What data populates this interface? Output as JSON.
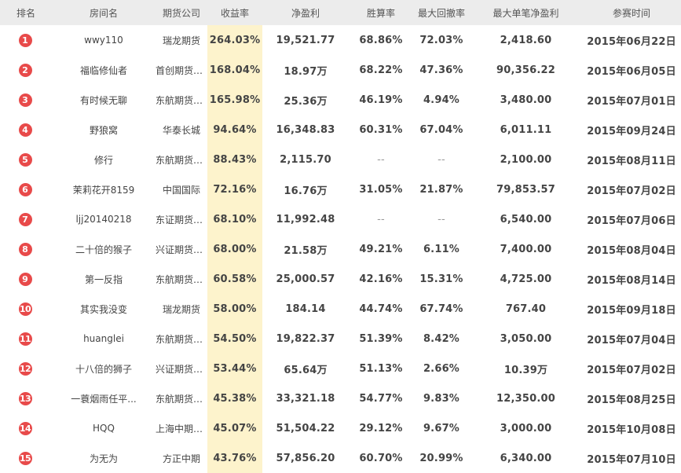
{
  "colors": {
    "badge": "#e84a4a",
    "header_bg": "#ececec",
    "highlight": "#fdf3cc"
  },
  "headers": [
    "排名",
    "房间名",
    "期货公司",
    "收益率",
    "净盈利",
    "胜算率",
    "最大回撤率",
    "最大单笔净盈利",
    "参赛时间"
  ],
  "rows": [
    {
      "rank": "1",
      "room": "wwy110",
      "company": "瑞龙期货",
      "return": "264.03%",
      "profit": "19,521.77",
      "win": "68.86%",
      "drawdown": "72.03%",
      "max_single": "2,418.60",
      "date": "2015年06月22日"
    },
    {
      "rank": "2",
      "room": "福临修仙者",
      "company": "首创期货主席",
      "return": "168.04%",
      "profit": "18.97万",
      "win": "68.22%",
      "drawdown": "47.36%",
      "max_single": "90,356.22",
      "date": "2015年06月05日"
    },
    {
      "rank": "3",
      "room": "有时候无聊",
      "company": "东航期货CTP",
      "return": "165.98%",
      "profit": "25.36万",
      "win": "46.19%",
      "drawdown": "4.94%",
      "max_single": "3,480.00",
      "date": "2015年07月01日"
    },
    {
      "rank": "4",
      "room": "野狼窝",
      "company": "华泰长城",
      "return": "94.64%",
      "profit": "16,348.83",
      "win": "60.31%",
      "drawdown": "67.04%",
      "max_single": "6,011.11",
      "date": "2015年09月24日"
    },
    {
      "rank": "5",
      "room": "修行",
      "company": "东航期货CTP",
      "return": "88.43%",
      "profit": "2,115.70",
      "win": "--",
      "drawdown": "--",
      "max_single": "2,100.00",
      "date": "2015年08月11日"
    },
    {
      "rank": "6",
      "room": "茉莉花开8159",
      "company": "中国国际",
      "return": "72.16%",
      "profit": "16.76万",
      "win": "31.05%",
      "drawdown": "21.87%",
      "max_single": "79,853.57",
      "date": "2015年07月02日"
    },
    {
      "rank": "7",
      "room": "ljj20140218",
      "company": "东证期货主席",
      "return": "68.10%",
      "profit": "11,992.48",
      "win": "--",
      "drawdown": "--",
      "max_single": "6,540.00",
      "date": "2015年07月06日"
    },
    {
      "rank": "8",
      "room": "二十倍的猴子",
      "company": "兴证期货主席",
      "return": "68.00%",
      "profit": "21.58万",
      "win": "49.21%",
      "drawdown": "6.11%",
      "max_single": "7,400.00",
      "date": "2015年08月04日"
    },
    {
      "rank": "9",
      "room": "第一反指",
      "company": "东航期货CTP",
      "return": "60.58%",
      "profit": "25,000.57",
      "win": "42.16%",
      "drawdown": "15.31%",
      "max_single": "4,725.00",
      "date": "2015年08月14日"
    },
    {
      "rank": "10",
      "room": "其实我没变",
      "company": "瑞龙期货",
      "return": "58.00%",
      "profit": "184.14",
      "win": "44.74%",
      "drawdown": "67.74%",
      "max_single": "767.40",
      "date": "2015年09月18日"
    },
    {
      "rank": "11",
      "room": "huanglei",
      "company": "东航期货CTP",
      "return": "54.50%",
      "profit": "19,822.37",
      "win": "51.39%",
      "drawdown": "8.42%",
      "max_single": "3,050.00",
      "date": "2015年07月04日"
    },
    {
      "rank": "12",
      "room": "十八倍的狮子",
      "company": "兴证期货主席",
      "return": "53.44%",
      "profit": "65.64万",
      "win": "51.13%",
      "drawdown": "2.66%",
      "max_single": "10.39万",
      "date": "2015年07月02日"
    },
    {
      "rank": "13",
      "room": "一蓑烟雨任平...",
      "company": "东航期货CTP",
      "return": "45.38%",
      "profit": "33,321.18",
      "win": "54.77%",
      "drawdown": "9.83%",
      "max_single": "12,350.00",
      "date": "2015年08月25日"
    },
    {
      "rank": "14",
      "room": "HQQ",
      "company": "上海中期二席",
      "return": "45.07%",
      "profit": "51,504.22",
      "win": "29.12%",
      "drawdown": "9.67%",
      "max_single": "3,000.00",
      "date": "2015年10月08日"
    },
    {
      "rank": "15",
      "room": "为无为",
      "company": "方正中期",
      "return": "43.76%",
      "profit": "57,856.20",
      "win": "60.70%",
      "drawdown": "20.99%",
      "max_single": "6,340.00",
      "date": "2015年07月10日"
    }
  ]
}
